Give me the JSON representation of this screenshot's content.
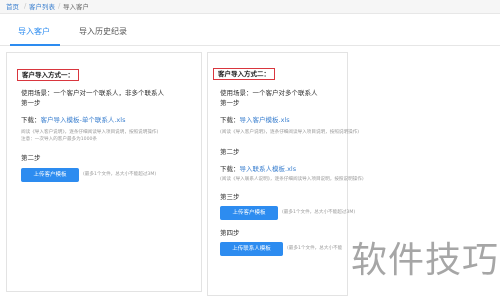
{
  "breadcrumb": {
    "home": "首页",
    "list": "客户列表",
    "current": "导入客户"
  },
  "tabs": [
    {
      "label": "导入客户"
    },
    {
      "label": "导入历史纪录"
    }
  ],
  "method1": {
    "title": "客户导入方式一：",
    "scene": "使用场景：一个客户对一个联系人，非多个联系人",
    "step1": "第一步",
    "download_prefix": "下载：",
    "download_link": "客户导入模板-单个联系人.xls",
    "read_note": "阅读《导入客户说明》，逐条仔细阅读导入项目说明，按照说明操作)",
    "note": "注意：一次导入的客户最多为1000条",
    "step2": "第二步",
    "upload_button": "上传客户模板",
    "upload_note": "(最多1个文件，总大小不能超过3M)"
  },
  "method2": {
    "title": "客户导入方式二：",
    "scene": "使用场景：一个客户对多个联系人",
    "step1": "第一步",
    "download1_prefix": "下载：",
    "download1_link": "导入客户模板.xls",
    "read_note1": "(阅读《导入客户说明》，逐条仔细阅读导入项目说明，按照说明操作)",
    "step2": "第二步",
    "download2_prefix": "下载：",
    "download2_link": "导入联系人模板.xls",
    "read_note2": "(阅读《导入联系人说明》，逐条仔细阅读导入项目说明，按照说明操作)",
    "step3": "第三步",
    "upload_customer_button": "上传客户模板",
    "upload_customer_note": "(最多1个文件，总大小不能超过3M)",
    "step4": "第四步",
    "upload_contact_button": "上传联系人模板",
    "upload_contact_note": "(最多1个文件，总大小不能"
  },
  "watermark": "软件技巧",
  "colors": {
    "primary": "#2d8cf0",
    "highlight_border": "#d9363e",
    "link": "#3a7fcf"
  }
}
